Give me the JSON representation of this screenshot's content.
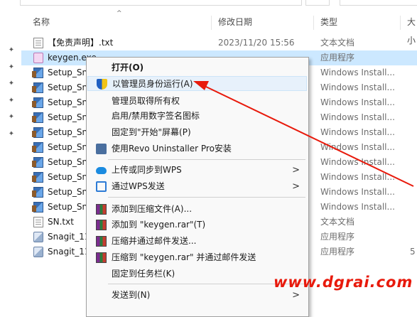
{
  "header": {
    "col_name": "名称",
    "col_date": "修改日期",
    "col_type": "类型",
    "col_size": "大小"
  },
  "files": [
    {
      "name": "【免责声明】.txt",
      "date": "2023/11/20 15:56",
      "type": "文本文档",
      "size": "",
      "icon": "txt"
    },
    {
      "name": "keygen.exe",
      "date": "",
      "type": "应用程序",
      "size": "",
      "icon": "exe"
    },
    {
      "name": "Setup_Sna",
      "date": "",
      "type": "Windows Install...",
      "size": "",
      "icon": "msi"
    },
    {
      "name": "Setup_Sna",
      "date": "",
      "type": "Windows Install...",
      "size": "",
      "icon": "msi"
    },
    {
      "name": "Setup_Sna",
      "date": "",
      "type": "Windows Install...",
      "size": "",
      "icon": "msi"
    },
    {
      "name": "Setup_Sna",
      "date": "",
      "type": "Windows Install...",
      "size": "",
      "icon": "msi"
    },
    {
      "name": "Setup_Sna",
      "date": "",
      "type": "Windows Install...",
      "size": "",
      "icon": "msi"
    },
    {
      "name": "Setup_Sna",
      "date": "",
      "type": "Windows Install...",
      "size": "",
      "icon": "msi"
    },
    {
      "name": "Setup_Sna",
      "date": "",
      "type": "Windows Install...",
      "size": "",
      "icon": "msi"
    },
    {
      "name": "Setup_Sna",
      "date": "",
      "type": "Windows Install...",
      "size": "",
      "icon": "msi"
    },
    {
      "name": "Setup_Sna",
      "date": "",
      "type": "Windows Install...",
      "size": "",
      "icon": "msi"
    },
    {
      "name": "Setup_Sna",
      "date": "",
      "type": "Windows Install...",
      "size": "",
      "icon": "msi"
    },
    {
      "name": "SN.txt",
      "date": "",
      "type": "文本文档",
      "size": "",
      "icon": "txt"
    },
    {
      "name": "Snagit_11",
      "date": "",
      "type": "应用程序",
      "size": "",
      "icon": "snagit"
    },
    {
      "name": "Snagit_11",
      "date": "",
      "type": "应用程序",
      "size": "5",
      "icon": "snagit"
    }
  ],
  "context_menu": {
    "open": "打开(O)",
    "run_as_admin": "以管理员身份运行(A)",
    "take_ownership": "管理员取得所有权",
    "toggle_signature_icon": "启用/禁用数字签名图标",
    "pin_start": "固定到\"开始\"屏幕(P)",
    "revo_uninstall": "使用Revo Uninstaller Pro安装",
    "wps_upload": "上传或同步到WPS",
    "wps_send": "通过WPS发送",
    "add_to_archive": "添加到压缩文件(A)...",
    "add_to_keygen_rar": "添加到 \"keygen.rar\"(T)",
    "compress_email": "压缩并通过邮件发送...",
    "compress_keygen_email": "压缩到 \"keygen.rar\" 并通过邮件发送",
    "pin_taskbar": "固定到任务栏(K)",
    "send_to": "发送到(N)"
  },
  "watermark": "www.dgrai.com",
  "colors": {
    "selection": "#cce8ff",
    "arrow": "#e81a0c",
    "watermark": "#e81a0c"
  }
}
